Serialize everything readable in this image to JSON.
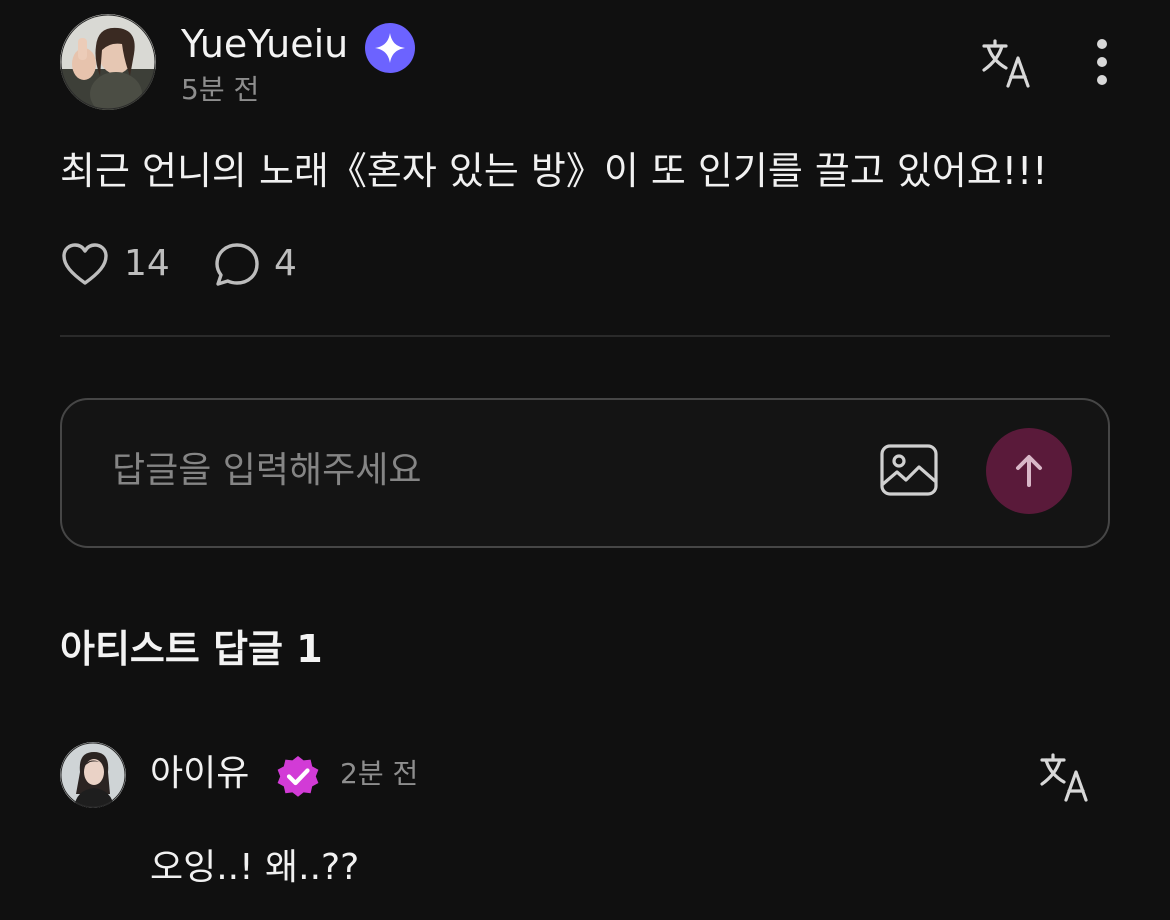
{
  "post": {
    "author": "YueYueiu",
    "time": "5분 전",
    "text": "최근 언니의 노래《혼자 있는 방》이 또 인기를 끌고 있어요!!!",
    "likes": "14",
    "comments": "4",
    "icons": {
      "avatar": "user-avatar-photo",
      "badge": "sparkle-badge-icon",
      "translate": "translate-icon",
      "more": "more-vertical-icon",
      "like": "heart-icon",
      "comment": "comment-bubble-icon"
    }
  },
  "reply": {
    "placeholder": "답글을 입력해주세요",
    "value": "",
    "icons": {
      "image": "image-icon",
      "send": "arrow-up-icon"
    }
  },
  "artist_replies": {
    "title": "아티스트 답글 1",
    "items": [
      {
        "author": "아이유",
        "time": "2분 전",
        "text": "오잉..! 왜..??",
        "icons": {
          "avatar": "artist-avatar-photo",
          "badge": "verified-badge-icon",
          "translate": "translate-icon"
        }
      }
    ]
  },
  "colors": {
    "background": "#101010",
    "sparkle_badge": "#6c63ff",
    "verified_badge": "#d23bd6",
    "send_button": "#5a1a3a",
    "muted_text": "#8e8e8e"
  }
}
